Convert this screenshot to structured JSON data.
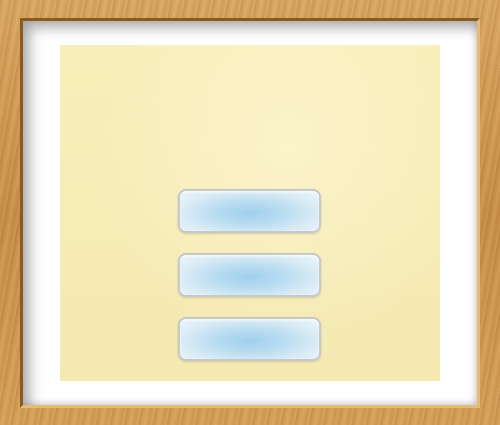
{
  "colors": {
    "frame_wood": "#c98f48",
    "mat": "#ffffff",
    "paper": "#f6ecb6",
    "button_fill": "#b8dcf0",
    "button_border": "#c6c9c9"
  },
  "menu": {
    "buttons": [
      {
        "label": ""
      },
      {
        "label": ""
      },
      {
        "label": ""
      }
    ]
  }
}
